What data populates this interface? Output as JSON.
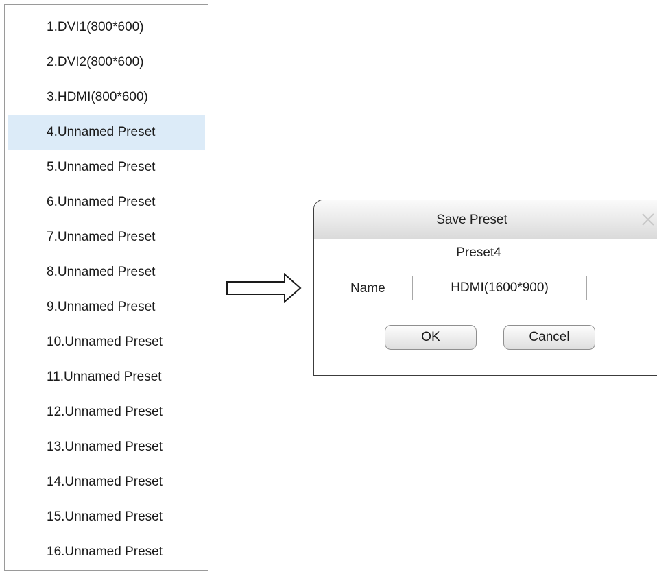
{
  "preset_list": {
    "items": [
      {
        "label": "1.DVI1(800*600)"
      },
      {
        "label": "2.DVI2(800*600)"
      },
      {
        "label": "3.HDMI(800*600)"
      },
      {
        "label": "4.Unnamed Preset",
        "selected": true
      },
      {
        "label": "5.Unnamed Preset"
      },
      {
        "label": "6.Unnamed Preset"
      },
      {
        "label": "7.Unnamed Preset"
      },
      {
        "label": "8.Unnamed Preset"
      },
      {
        "label": "9.Unnamed Preset"
      },
      {
        "label": "10.Unnamed Preset"
      },
      {
        "label": "11.Unnamed Preset"
      },
      {
        "label": "12.Unnamed Preset"
      },
      {
        "label": "13.Unnamed Preset"
      },
      {
        "label": "14.Unnamed Preset"
      },
      {
        "label": "15.Unnamed Preset"
      },
      {
        "label": "16.Unnamed Preset"
      }
    ],
    "selected_color": "#dcebf8"
  },
  "arrow_icon": "right-arrow-icon",
  "dialog": {
    "title": "Save Preset",
    "close_icon": "close-icon",
    "preset_number": "Preset4",
    "name_label": "Name",
    "name_value": "HDMI(1600*900)",
    "ok_label": "OK",
    "cancel_label": "Cancel"
  }
}
